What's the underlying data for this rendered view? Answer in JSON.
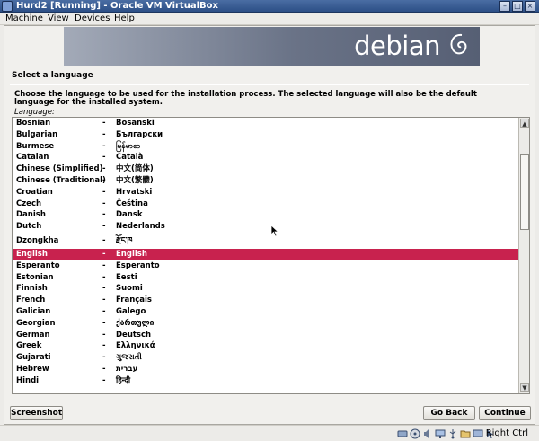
{
  "window": {
    "title": "Hurd2 [Running] - Oracle VM VirtualBox"
  },
  "menubar": {
    "items": [
      "Machine",
      "View",
      "Devices",
      "Help"
    ]
  },
  "banner": {
    "logo_text": "debian"
  },
  "installer": {
    "section_title": "Select a language",
    "instructions": "Choose the language to be used for the installation process. The selected language will also be the default language for the installed system.",
    "list_label": "Language:",
    "separator": "-",
    "languages": [
      {
        "english": "Bosnian",
        "native": "Bosanski"
      },
      {
        "english": "Bulgarian",
        "native": "Български"
      },
      {
        "english": "Burmese",
        "native": "မြန်မာစာ"
      },
      {
        "english": "Catalan",
        "native": "Català"
      },
      {
        "english": "Chinese (Simplified)",
        "native": "中文(简体)"
      },
      {
        "english": "Chinese (Traditional)",
        "native": "中文(繁體)"
      },
      {
        "english": "Croatian",
        "native": "Hrvatski"
      },
      {
        "english": "Czech",
        "native": "Čeština"
      },
      {
        "english": "Danish",
        "native": "Dansk"
      },
      {
        "english": "Dutch",
        "native": "Nederlands"
      },
      {
        "english": "Dzongkha",
        "native": "རྫོང་ཁ"
      },
      {
        "english": "English",
        "native": "English"
      },
      {
        "english": "Esperanto",
        "native": "Esperanto"
      },
      {
        "english": "Estonian",
        "native": "Eesti"
      },
      {
        "english": "Finnish",
        "native": "Suomi"
      },
      {
        "english": "French",
        "native": "Français"
      },
      {
        "english": "Galician",
        "native": "Galego"
      },
      {
        "english": "Georgian",
        "native": "ქართული"
      },
      {
        "english": "German",
        "native": "Deutsch"
      },
      {
        "english": "Greek",
        "native": "Ελληνικά"
      },
      {
        "english": "Gujarati",
        "native": "ગુજરાતી"
      },
      {
        "english": "Hebrew",
        "native": "עברית"
      },
      {
        "english": "Hindi",
        "native": "हिन्दी"
      }
    ],
    "selected_language": "English",
    "buttons": {
      "screenshot": "Screenshot",
      "back": "Go Back",
      "continue": "Continue"
    }
  },
  "statusbar": {
    "host_key": "Right Ctrl"
  },
  "colors": {
    "selection": "#c8224e",
    "titlebar": "#2c4f86"
  }
}
